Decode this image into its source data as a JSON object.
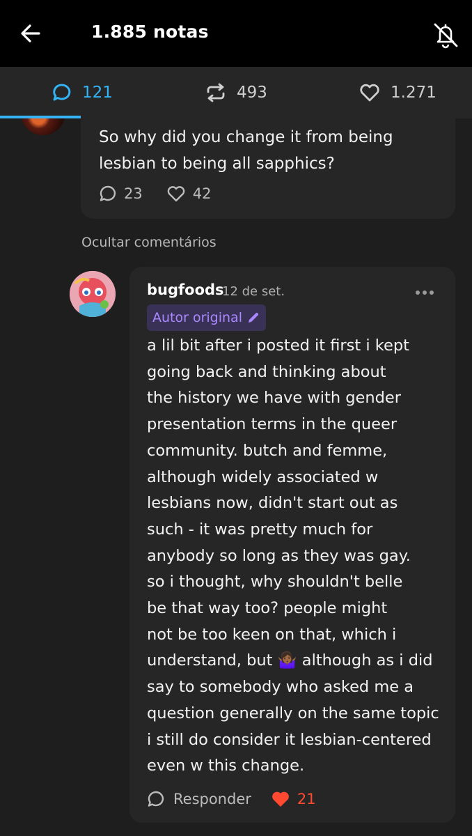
{
  "header": {
    "title": "1.885 notas",
    "back_icon": "arrow-left-icon",
    "bell_icon": "bell-off-icon"
  },
  "tabs": [
    {
      "icon": "comment-icon",
      "count": "121",
      "active": true
    },
    {
      "icon": "reblog-icon",
      "count": "493",
      "active": false
    },
    {
      "icon": "heart-icon",
      "count": "1.271",
      "active": false
    }
  ],
  "parent_comment": {
    "text": "So why did you change it from being lesbian to being all sapphics?",
    "replies": "23",
    "likes": "42"
  },
  "hide_comments_label": "Ocultar comentários",
  "reply": {
    "username": "bugfoods",
    "date": "12 de set.",
    "badge": "Autor original",
    "lines": [
      "a lil bit after i posted it first i kept",
      "going back and thinking about",
      "the history we have with gender",
      "presentation terms in the queer",
      "community. butch and femme,",
      "although widely associated w",
      "lesbians now, didn't start out as",
      "such - it was pretty much for",
      "anybody so long as they was gay.",
      "so i thought, why shouldn't belle",
      "be that way too? people might",
      "not be too keen on that, which i",
      "understand, but",
      "although as i did",
      "say to somebody who asked me a",
      "question generally on the same topic",
      "i still do consider it lesbian-centered",
      "even w this change."
    ],
    "emoji": "🤷🏾‍♀️",
    "reply_label": "Responder",
    "likes": "21",
    "like_color": "#ff4930"
  },
  "colors": {
    "accent": "#34b4f5",
    "badge_text": "#a988ff",
    "badge_bg": "#3a3156"
  }
}
